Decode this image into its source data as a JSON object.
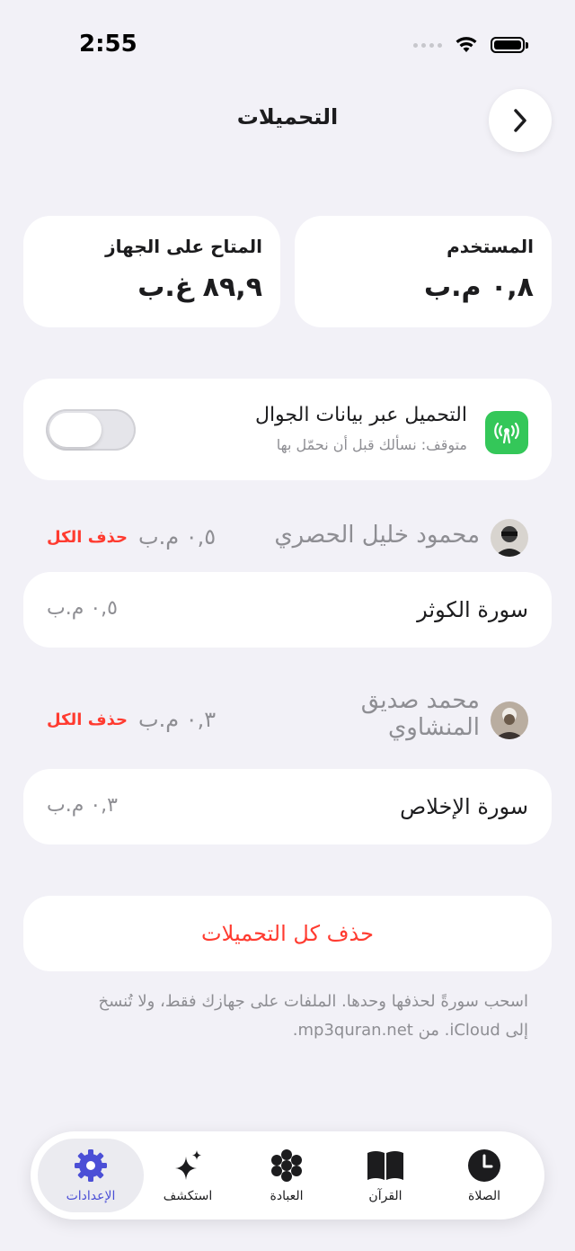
{
  "status": {
    "time": "2:55"
  },
  "nav": {
    "title": "التحميلات"
  },
  "storage": {
    "user_label": "المستخدم",
    "user_value": "٠,٨ م.ب",
    "device_label": "المتاح على الجهاز",
    "device_value": "٨٩,٩ غ.ب"
  },
  "cellular": {
    "title": "التحميل عبر بيانات الجوال",
    "subtitle": "متوقف: نسألك قبل أن نحمّل بها",
    "enabled": false
  },
  "reciters": [
    {
      "name": "محمود خليل الحصري",
      "size": "٠,٥ م.ب",
      "delete_all": "حذف الكل",
      "items": [
        {
          "title": "سورة الكوثر",
          "size": "٠,٥ م.ب"
        }
      ]
    },
    {
      "name_line1": "محمد صديق",
      "name_line2": "المنشاوي",
      "size": "٠,٣ م.ب",
      "delete_all": "حذف الكل",
      "items": [
        {
          "title": "سورة الإخلاص",
          "size": "٠,٣ م.ب"
        }
      ]
    }
  ],
  "delete_all_downloads": "حذف كل التحميلات",
  "footer": {
    "line1": "اسحب سورةً لحذفها وحدها. الملفات على جهازك فقط، ولا تُنسخ",
    "line2": "إلى iCloud. من mp3quran.net."
  },
  "tabs": [
    {
      "label": "الصلاة",
      "icon": "clock-icon"
    },
    {
      "label": "القرآن",
      "icon": "book-icon"
    },
    {
      "label": "العبادة",
      "icon": "flower-icon"
    },
    {
      "label": "استكشف",
      "icon": "sparkles-icon"
    },
    {
      "label": "الإعدادات",
      "icon": "gear-icon",
      "active": true
    }
  ],
  "colors": {
    "accent": "#4b4fd6",
    "destructive": "#ff3b30",
    "cellular_icon": "#34c759"
  }
}
